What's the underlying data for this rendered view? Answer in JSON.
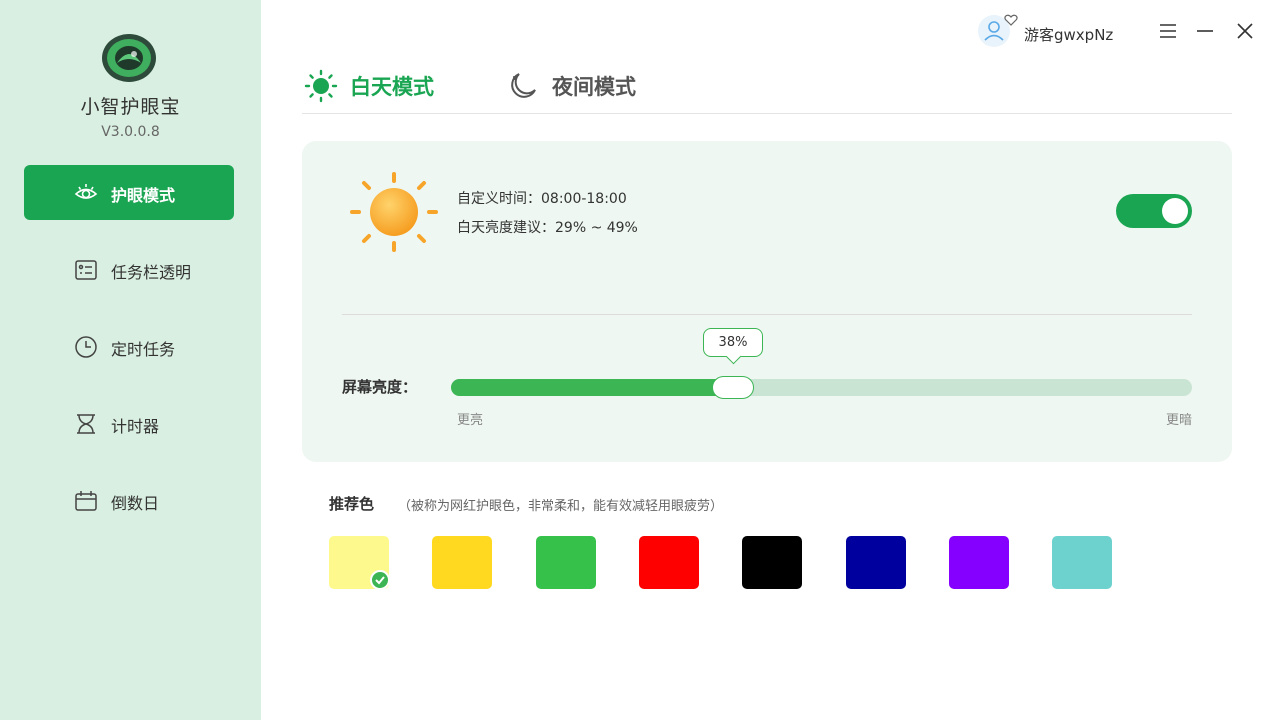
{
  "app": {
    "name": "小智护眼宝",
    "version": "V3.0.0.8"
  },
  "sidebar": {
    "items": [
      {
        "label": "护眼模式",
        "icon": "eye-icon",
        "active": true
      },
      {
        "label": "任务栏透明",
        "icon": "taskbar-icon",
        "active": false
      },
      {
        "label": "定时任务",
        "icon": "clock-icon",
        "active": false
      },
      {
        "label": "计时器",
        "icon": "hourglass-icon",
        "active": false
      },
      {
        "label": "倒数日",
        "icon": "calendar-icon",
        "active": false
      }
    ]
  },
  "header": {
    "user_name": "游客gwxpNz",
    "controls": [
      "menu-icon",
      "minimize-icon",
      "close-icon"
    ]
  },
  "tabs": [
    {
      "label": "白天模式",
      "icon": "sun-icon",
      "active": true
    },
    {
      "label": "夜间模式",
      "icon": "moon-icon",
      "active": false
    }
  ],
  "day_card": {
    "custom_time": "自定义时间：08:00-18:00",
    "brightness_tip": "白天亮度建议：29% ~ 49%",
    "toggle_on": true,
    "brightness": {
      "label": "屏幕亮度：",
      "value_text": "38%",
      "value": 38,
      "brighter": "更亮",
      "darker": "更暗"
    }
  },
  "recommended": {
    "title": "推荐色",
    "description": "（被称为网红护眼色，非常柔和，能有效减轻用眼疲劳）",
    "colors": [
      "#fdf98c",
      "#ffd820",
      "#35c14a",
      "#ff0000",
      "#000000",
      "#00009e",
      "#8500ff",
      "#6dd1ce"
    ],
    "selected_index": 0
  },
  "theme": {
    "accent": "#1aa552",
    "sidebar_bg": "#d9efe1",
    "card_bg": "#eef7f1",
    "slider_fill": "#3cb554",
    "slider_track": "#c9e4d3"
  }
}
